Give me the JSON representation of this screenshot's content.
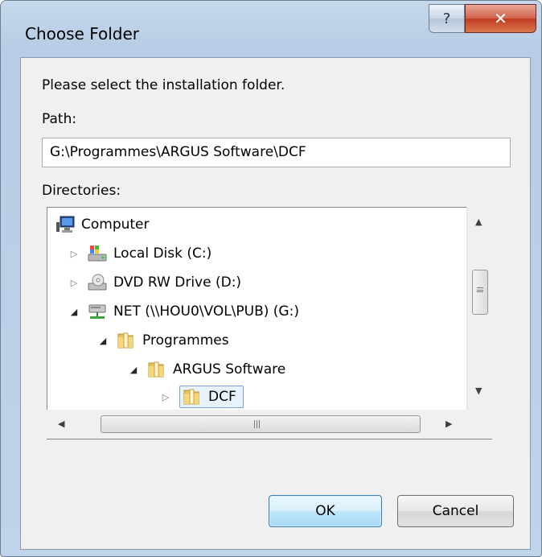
{
  "window": {
    "title": "Choose Folder",
    "help_glyph": "?",
    "close_glyph": "✕"
  },
  "dialog": {
    "instruction": "Please select the installation folder.",
    "path_label": "Path:",
    "path_value": "G:\\Programmes\\ARGUS Software\\DCF",
    "directories_label": "Directories:"
  },
  "tree": {
    "items": [
      {
        "label": "Computer",
        "icon": "computer-icon",
        "state": "expanded"
      },
      {
        "label": "Local Disk (C:)",
        "icon": "local-disk-icon",
        "state": "collapsed"
      },
      {
        "label": "DVD RW Drive (D:)",
        "icon": "dvd-drive-icon",
        "state": "collapsed"
      },
      {
        "label": "NET (\\\\HOU0\\VOL\\PUB) (G:)",
        "icon": "network-drive-icon",
        "state": "expanded"
      },
      {
        "label": "Programmes",
        "icon": "folder-icon",
        "state": "expanded"
      },
      {
        "label": "ARGUS Software",
        "icon": "folder-icon",
        "state": "expanded"
      },
      {
        "label": "DCF",
        "icon": "folder-icon",
        "state": "collapsed",
        "selected": true
      }
    ],
    "scroll_up": "▲",
    "scroll_down": "▼",
    "scroll_left": "◀",
    "scroll_right": "▶"
  },
  "buttons": {
    "ok": "OK",
    "cancel": "Cancel"
  },
  "colors": {
    "selection_border": "#7da2ce",
    "selection_fill": "#e8f2fd",
    "folder": "#e8c25a"
  }
}
